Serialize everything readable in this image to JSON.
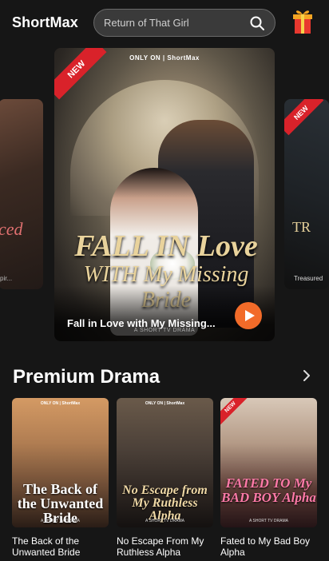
{
  "header": {
    "logo": "ShortMax",
    "search_placeholder": "Return of That Girl"
  },
  "carousel": {
    "left_card": {
      "title_fragment": "ced",
      "caption_fragment": "pir..."
    },
    "right_card": {
      "ribbon": "NEW",
      "title_fragment": "TR",
      "caption_fragment": "Treasured"
    },
    "main": {
      "ribbon": "NEW",
      "only_on": "ONLY ON | ShortMax",
      "title_line1": "FALL IN Love",
      "title_line2": "WITH My Missing Bride",
      "caption": "Fall in Love with My Missing...",
      "sub_caption": "A SHORT TV DRAMA"
    }
  },
  "section": {
    "title": "Premium Drama",
    "items": [
      {
        "poster_top": "ONLY ON | ShortMax",
        "poster_title": "The Back of the Unwanted Bride",
        "poster_bottom": "A SHORT TV DRAMA",
        "label": "The Back of the Unwanted Bride"
      },
      {
        "poster_top": "ONLY ON | ShortMax",
        "poster_title": "No Escape from My Ruthless Alpha",
        "poster_bottom": "A SHORT TV DRAMA",
        "label": "No Escape From My Ruthless Alpha"
      },
      {
        "ribbon": "NEW",
        "poster_title": "FATED TO My BAD BOY Alpha",
        "poster_bottom": "A SHORT TV DRAMA",
        "label": "Fated to My Bad Boy Alpha"
      }
    ]
  },
  "icons": {
    "search": "search-icon",
    "gift": "gift-icon",
    "play": "play-icon",
    "chevron": "chevron-right-icon"
  },
  "colors": {
    "accent": "#f26b29",
    "ribbon": "#d9222a",
    "background": "#161616"
  }
}
